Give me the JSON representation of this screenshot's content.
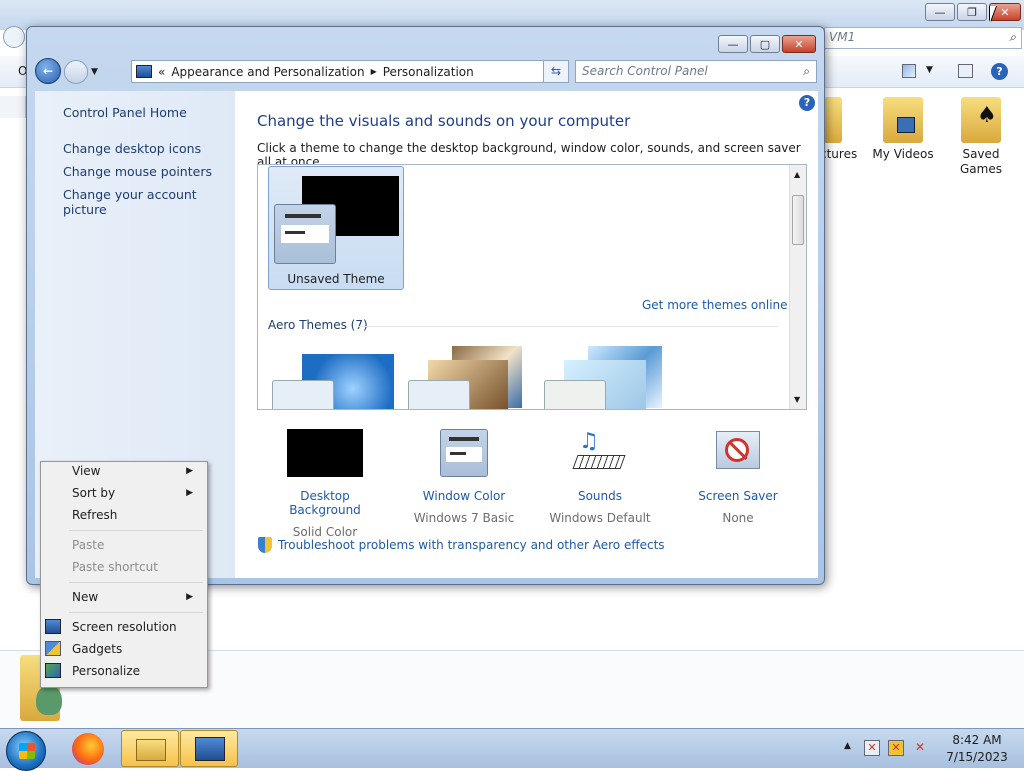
{
  "background_window": {
    "search_text": "VM1",
    "toolbar_letter": "O",
    "folders": [
      {
        "label": "ctures"
      },
      {
        "label": "My Videos"
      },
      {
        "label": "Saved Games"
      }
    ]
  },
  "control_panel": {
    "breadcrumb": {
      "prefix": "«",
      "item1": "Appearance and Personalization",
      "separator": "▶",
      "item2": "Personalization"
    },
    "search_placeholder": "Search Control Panel",
    "sidebar": {
      "home": "Control Panel Home",
      "links": [
        "Change desktop icons",
        "Change mouse pointers",
        "Change your account picture"
      ]
    },
    "heading": "Change the visuals and sounds on your computer",
    "description": "Click a theme to change the desktop background, window color, sounds, and screen saver all at once.",
    "unsaved_theme": "Unsaved Theme",
    "more_themes": "Get more themes online",
    "aero_group": "Aero Themes (7)",
    "settings": [
      {
        "label": "Desktop Background",
        "value": "Solid Color"
      },
      {
        "label": "Window Color",
        "value": "Windows 7 Basic"
      },
      {
        "label": "Sounds",
        "value": "Windows Default"
      },
      {
        "label": "Screen Saver",
        "value": "None"
      }
    ],
    "troubleshoot": "Troubleshoot problems with transparency and other Aero effects",
    "help": "?"
  },
  "context_menu": {
    "items": [
      {
        "label": "View",
        "submenu": true,
        "disabled": false
      },
      {
        "label": "Sort by",
        "submenu": true,
        "disabled": false
      },
      {
        "label": "Refresh",
        "submenu": false,
        "disabled": false
      },
      {
        "label": "Paste",
        "submenu": false,
        "disabled": true
      },
      {
        "label": "Paste shortcut",
        "submenu": false,
        "disabled": true
      },
      {
        "label": "New",
        "submenu": true,
        "disabled": false
      },
      {
        "label": "Screen resolution",
        "submenu": false,
        "disabled": false
      },
      {
        "label": "Gadgets",
        "submenu": false,
        "disabled": false
      },
      {
        "label": "Personalize",
        "submenu": false,
        "disabled": false
      }
    ],
    "arrow": "▶"
  },
  "taskbar": {
    "time": "8:42 AM",
    "date": "7/15/2023",
    "tray_arrow": "▲"
  },
  "colors": {
    "link": "#1e5aa8",
    "heading": "#1e3d8f"
  }
}
